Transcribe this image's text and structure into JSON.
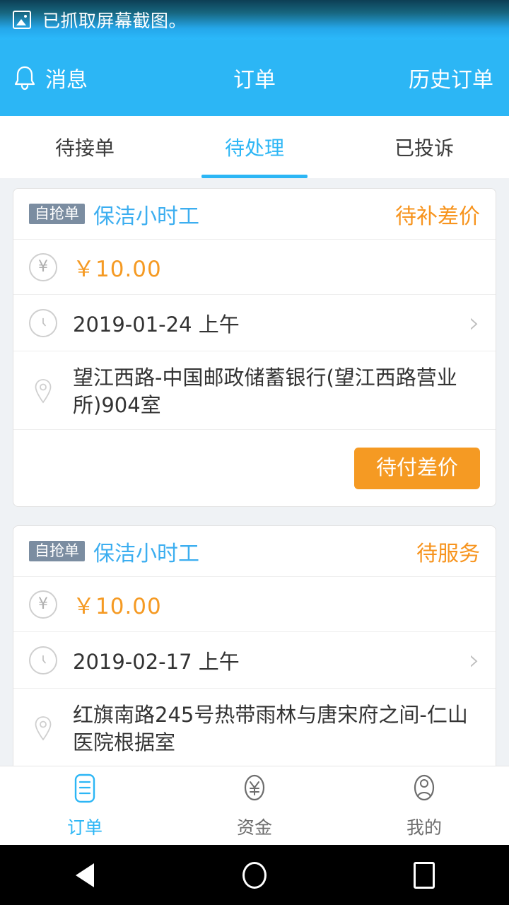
{
  "statusbar": {
    "icon": "image-screenshot-icon",
    "text": "已抓取屏幕截图。"
  },
  "header": {
    "bell_icon": "bell-icon",
    "left_label": "消息",
    "title": "订单",
    "right_label": "历史订单",
    "background": "#2cb6f5"
  },
  "tabs": {
    "items": [
      {
        "label": "待接单",
        "active": false
      },
      {
        "label": "待处理",
        "active": true
      },
      {
        "label": "已投诉",
        "active": false
      }
    ],
    "active_color": "#2cb6f5"
  },
  "orders": [
    {
      "badge": "自抢单",
      "service": "保洁小时工",
      "status": "待补差价",
      "status_color": "#f7941e",
      "price_icon": "yen-circle-icon",
      "price": "￥10.00",
      "clock_icon": "clock-icon",
      "date": "2019-01-24 上午",
      "chevron_icon": "chevron-right-icon",
      "location_icon": "map-pin-icon",
      "address": "望江西路-中国邮政储蓄银行(望江西路营业所)904室",
      "buttons": [
        {
          "label": "待付差价",
          "style": "orange"
        }
      ]
    },
    {
      "badge": "自抢单",
      "service": "保洁小时工",
      "status": "待服务",
      "status_color": "#f7941e",
      "price_icon": "yen-circle-icon",
      "price": "￥10.00",
      "clock_icon": "clock-icon",
      "date": "2019-02-17 上午",
      "chevron_icon": "chevron-right-icon",
      "location_icon": "map-pin-icon",
      "address": "红旗南路245号热带雨林与唐宋府之间-仁山医院根据室",
      "buttons": [
        {
          "label": "",
          "style": "outline"
        },
        {
          "label": "",
          "style": "outline"
        },
        {
          "label": "",
          "style": "orange"
        }
      ]
    }
  ],
  "bottom_nav": {
    "items": [
      {
        "label": "订单",
        "icon": "order-list-icon",
        "active": true
      },
      {
        "label": "资金",
        "icon": "yen-circle-icon",
        "active": false
      },
      {
        "label": "我的",
        "icon": "user-circle-icon",
        "active": false
      }
    ],
    "active_color": "#2cb6f5"
  },
  "android_nav": {
    "back_icon": "triangle-back-icon",
    "home_icon": "circle-home-icon",
    "recents_icon": "square-recents-icon"
  }
}
